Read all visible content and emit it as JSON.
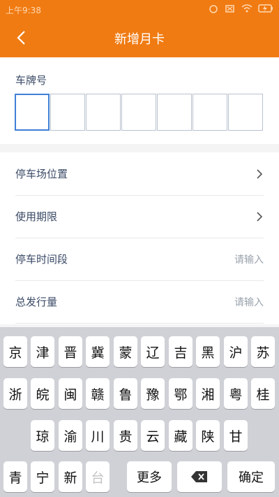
{
  "status": {
    "time": "上午9:38"
  },
  "header": {
    "title": "新增月卡"
  },
  "plate": {
    "label": "车牌号",
    "box_count": 7
  },
  "form": {
    "rows": [
      {
        "label": "停车场位置",
        "placeholder": "",
        "type": "chevron"
      },
      {
        "label": "使用期限",
        "placeholder": "",
        "type": "chevron"
      },
      {
        "label": "停车时间段",
        "placeholder": "请输入",
        "type": "input"
      },
      {
        "label": "总发行量",
        "placeholder": "请输入",
        "type": "input"
      }
    ]
  },
  "keyboard": {
    "row1": [
      "京",
      "津",
      "晋",
      "冀",
      "蒙",
      "辽",
      "吉",
      "黑",
      "沪",
      "苏"
    ],
    "row2": [
      "浙",
      "皖",
      "闽",
      "赣",
      "鲁",
      "豫",
      "鄂",
      "湘",
      "粤",
      "桂"
    ],
    "row3": [
      "琼",
      "渝",
      "川",
      "贵",
      "云",
      "藏",
      "陕",
      "甘"
    ],
    "row4": [
      "青",
      "宁",
      "新",
      "台"
    ],
    "more": "更多",
    "confirm": "确定"
  },
  "colors": {
    "accent": "#f07b12",
    "focus": "#3f7fd6"
  },
  "icons": {
    "back": "chevron-left-icon",
    "row": "chevron-right-icon",
    "delete": "backspace-icon"
  }
}
